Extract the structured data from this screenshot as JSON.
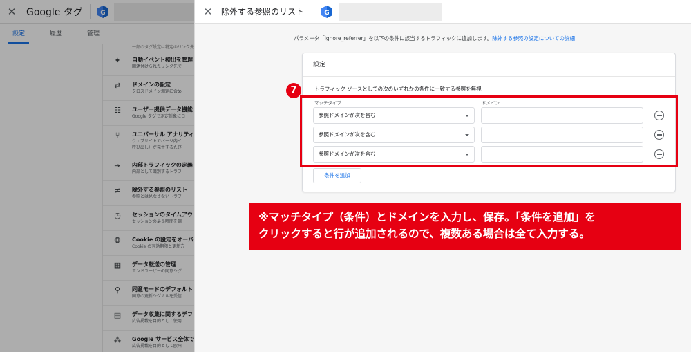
{
  "background": {
    "header": {
      "title": "Google タグ"
    },
    "tabs": [
      {
        "label": "設定",
        "active": true
      },
      {
        "label": "履歴",
        "active": false
      },
      {
        "label": "管理",
        "active": false
      }
    ],
    "top_note": "一部のタグ設定は特定のリンク先に",
    "items": [
      {
        "icon": "✦",
        "icon_name": "sparkle-icon",
        "title": "自動イベント検出を管理",
        "desc": "関連付けられたリンク先で"
      },
      {
        "icon": "⇄",
        "icon_name": "cross-domain-icon",
        "title": "ドメインの設定",
        "desc": "クロスドメイン測定に含め"
      },
      {
        "icon": "☷",
        "icon_name": "user-data-icon",
        "title": "ユーザー提供データ機能",
        "desc": "Google タグで測定対象にコ"
      },
      {
        "icon": "⑂",
        "icon_name": "fork-icon",
        "title": "ユニバーサル アナリティ",
        "desc": "ウェブサイトでページ内イ",
        "desc2": "呼び出し）が発生するたび"
      },
      {
        "icon": "⇥",
        "icon_name": "internal-traffic-icon",
        "title": "内部トラフィックの定義",
        "desc": "内部として識別するトラフ"
      },
      {
        "icon": "≠",
        "icon_name": "exclude-referral-icon",
        "title": "除外する参照のリスト",
        "desc": "参照とは見なさないトラフ"
      },
      {
        "icon": "◷",
        "icon_name": "clock-icon",
        "title": "セッションのタイムアウ",
        "desc": "セッションの最長時間を調"
      },
      {
        "icon": "❂",
        "icon_name": "cookie-icon",
        "title": "Cookie の設定をオーバー",
        "desc": "Cookie の有効期限と更新方"
      },
      {
        "icon": "▦",
        "icon_name": "data-transfer-icon",
        "title": "データ転送の管理",
        "desc": "エンドユーザーの同意シグ"
      },
      {
        "icon": "⚲",
        "icon_name": "consent-icon",
        "title": "同意モードのデフォルト",
        "desc": "同意の更新シグナルを受信"
      },
      {
        "icon": "▤",
        "icon_name": "data-collection-icon",
        "title": "データ収集に関するデフ",
        "desc": "広告掲載を目的として使用"
      },
      {
        "icon": "⁂",
        "icon_name": "google-services-icon",
        "title": "Google サービス全体で",
        "desc": "広告掲載を目的として欧州"
      }
    ]
  },
  "panel": {
    "title": "除外する参照のリスト",
    "intro_text": "パラメータ「ignore_referrer」を以下の条件に該当するトラフィックに追加します。",
    "intro_link": "除外する参照の設定についての詳細",
    "card_title": "設定",
    "subtitle": "トラフィック ソースとしての次のいずれかの条件に一致する参照を無視",
    "match_type_label": "マッチタイプ",
    "domain_label": "ドメイン",
    "rows": [
      {
        "match_type": "参照ドメインが次を含む",
        "domain": ""
      },
      {
        "match_type": "参照ドメインが次を含む",
        "domain": ""
      },
      {
        "match_type": "参照ドメインが次を含む",
        "domain": ""
      }
    ],
    "add_condition_label": "条件を追加"
  },
  "annotation": {
    "step_number": "7",
    "callout_line1": "※マッチタイプ（条件）とドメインを入力し、保存。「条件を追加」を",
    "callout_line2": "クリックすると行が追加されるので、複数ある場合は全て入力する。",
    "color": "#e60012"
  },
  "colors": {
    "accent": "#1a73e8",
    "annotation_red": "#e60012"
  }
}
